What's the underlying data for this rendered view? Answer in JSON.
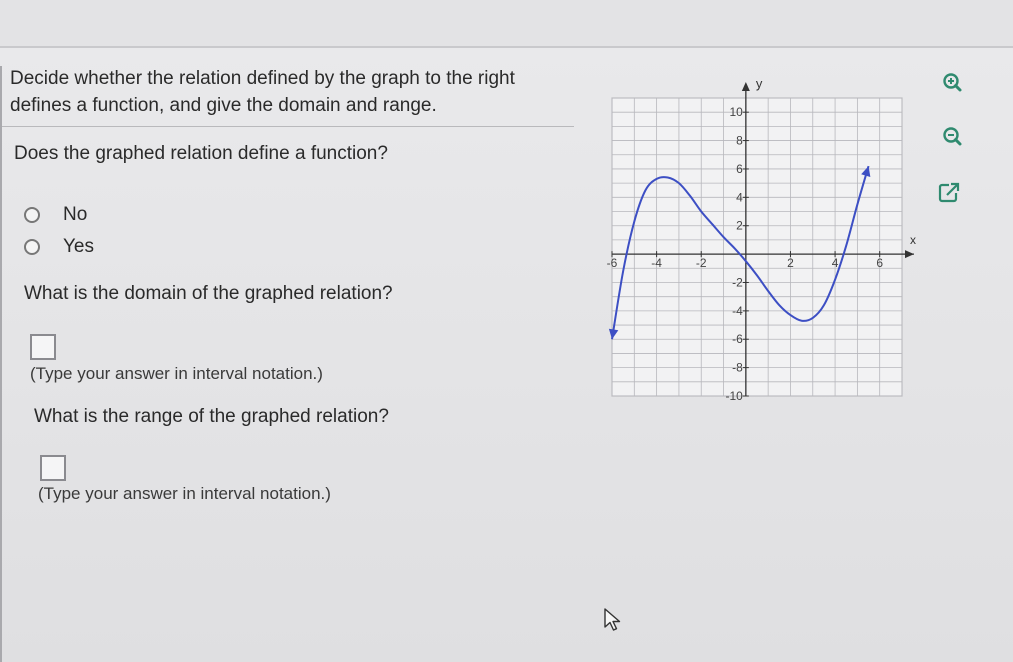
{
  "question": {
    "prompt_line1": "Decide whether the relation defined by the graph to the right",
    "prompt_line2": "defines a function, and give the domain and range.",
    "function_question": "Does the graphed relation define a function?",
    "options": [
      "No",
      "Yes"
    ],
    "domain_question": "What is the domain of the graphed relation?",
    "domain_hint": "(Type your answer in interval notation.)",
    "range_question": "What is the range of the graphed relation?",
    "range_hint": "(Type your answer in interval notation.)"
  },
  "tools": {
    "zoom_in": "zoom-in-icon",
    "zoom_out": "zoom-out-icon",
    "popout": "popout-icon"
  },
  "chart_data": {
    "type": "line",
    "xlabel": "x",
    "ylabel": "y",
    "xlim": [
      -6,
      7
    ],
    "ylim": [
      -10,
      11
    ],
    "x_ticks": [
      -6,
      -4,
      -2,
      2,
      4,
      6
    ],
    "y_ticks": [
      10,
      8,
      6,
      4,
      2,
      -2,
      -4,
      -6,
      -8,
      -10
    ],
    "x_tick_labels": [
      "-6",
      "-4",
      "-2",
      "2",
      "4",
      "6"
    ],
    "y_tick_labels": [
      "10",
      "8",
      "6",
      "4",
      "2",
      "-2",
      "-4",
      "-6",
      "-8",
      "-10"
    ],
    "grid": true,
    "series": [
      {
        "color": "#3d4fc4",
        "arrow_ends": true,
        "points": [
          [
            -6,
            -6
          ],
          [
            -5.5,
            -1.2
          ],
          [
            -5,
            2.3
          ],
          [
            -4.5,
            4.5
          ],
          [
            -4,
            5.3
          ],
          [
            -3.5,
            5.4
          ],
          [
            -3,
            5
          ],
          [
            -2.5,
            4.1
          ],
          [
            -2,
            3
          ],
          [
            -1.5,
            2.1
          ],
          [
            -1,
            1.2
          ],
          [
            -0.5,
            0.4
          ],
          [
            0,
            -0.5
          ],
          [
            0.5,
            -1.5
          ],
          [
            1,
            -2.6
          ],
          [
            1.5,
            -3.6
          ],
          [
            2,
            -4.3
          ],
          [
            2.5,
            -4.7
          ],
          [
            3,
            -4.5
          ],
          [
            3.5,
            -3.6
          ],
          [
            4,
            -1.8
          ],
          [
            4.5,
            0.6
          ],
          [
            5,
            3.5
          ],
          [
            5.5,
            6.2
          ]
        ]
      }
    ]
  }
}
